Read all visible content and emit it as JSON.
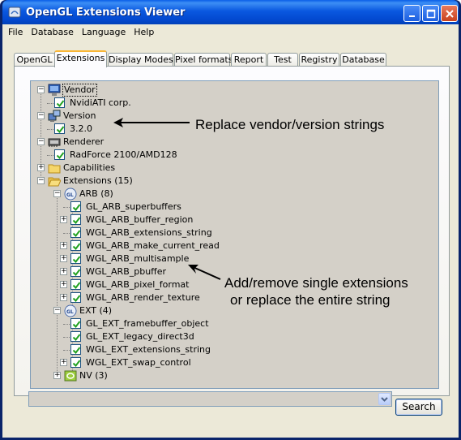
{
  "window": {
    "title": "OpenGL Extensions Viewer"
  },
  "menu": [
    "File",
    "Database",
    "Language",
    "Help"
  ],
  "tabs": [
    {
      "label": "OpenGL",
      "active": false
    },
    {
      "label": "Extensions",
      "active": true
    },
    {
      "label": "Display Modes",
      "active": false
    },
    {
      "label": "Pixel formats",
      "active": false
    },
    {
      "label": "Report",
      "active": false
    },
    {
      "label": "Test",
      "active": false
    },
    {
      "label": "Registry",
      "active": false
    },
    {
      "label": "Database",
      "active": false
    }
  ],
  "tree": {
    "vendor": {
      "label": "Vendor",
      "value": "NvidiATI corp.",
      "icon": "monitor-icon"
    },
    "version": {
      "label": "Version",
      "value": "3.2.0",
      "icon": "network-icon"
    },
    "renderer": {
      "label": "Renderer",
      "value": "RadForce 2100/AMD128",
      "icon": "gpu-card-icon"
    },
    "capabilities": {
      "label": "Capabilities",
      "icon": "folder-icon"
    },
    "extensions": {
      "label": "Extensions (15)",
      "icon": "folder-open-icon",
      "groups": [
        {
          "label": "ARB (8)",
          "items": [
            {
              "label": "GL_ARB_superbuffers",
              "expandable": false
            },
            {
              "label": "WGL_ARB_buffer_region",
              "expandable": true
            },
            {
              "label": "WGL_ARB_extensions_string",
              "expandable": false
            },
            {
              "label": "WGL_ARB_make_current_read",
              "expandable": true
            },
            {
              "label": "WGL_ARB_multisample",
              "expandable": true
            },
            {
              "label": "WGL_ARB_pbuffer",
              "expandable": true
            },
            {
              "label": "WGL_ARB_pixel_format",
              "expandable": true
            },
            {
              "label": "WGL_ARB_render_texture",
              "expandable": true
            }
          ]
        },
        {
          "label": "EXT (4)",
          "items": [
            {
              "label": "GL_EXT_framebuffer_object",
              "expandable": false
            },
            {
              "label": "GL_EXT_legacy_direct3d",
              "expandable": false
            },
            {
              "label": "WGL_EXT_extensions_string",
              "expandable": false
            },
            {
              "label": "WGL_EXT_swap_control",
              "expandable": true
            }
          ]
        },
        {
          "label": "NV (3)",
          "items": []
        }
      ]
    }
  },
  "annotations": {
    "top": "Replace vendor/version strings",
    "middle_line1": "Add/remove single extensions",
    "middle_line2": "or replace the entire string"
  },
  "search": {
    "value": "",
    "button_label": "Search"
  },
  "colors": {
    "titlebar": "#0a5ee8",
    "tree_background": "#d4d0c8",
    "check": "#21a121",
    "active_tab_accent": "#f9b635"
  }
}
